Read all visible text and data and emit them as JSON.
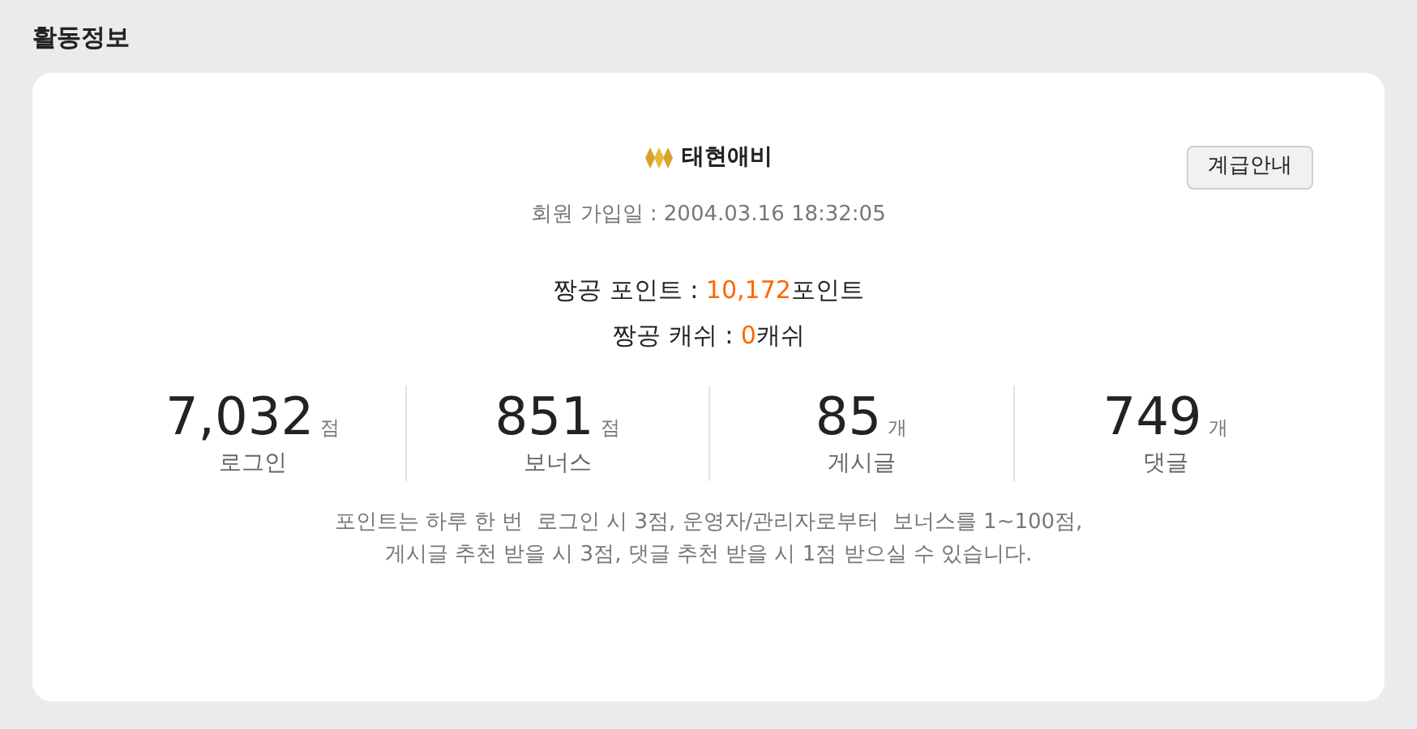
{
  "section_title": "활동정보",
  "member": {
    "name": "태현애비",
    "joined_label": "회원 가입일 : 2004.03.16 18:32:05",
    "grade_button": "계급안내"
  },
  "balances": [
    {
      "label": "짱공 포인트 : ",
      "value": "10,172",
      "unit": "포인트"
    },
    {
      "label": "짱공 캐쉬 : ",
      "value": "0",
      "unit": "캐쉬"
    }
  ],
  "stats": [
    {
      "value": "7,032",
      "unit": "점",
      "label": "로그인"
    },
    {
      "value": "851",
      "unit": "점",
      "label": "보너스"
    },
    {
      "value": "85",
      "unit": "개",
      "label": "게시글"
    },
    {
      "value": "749",
      "unit": "개",
      "label": "댓글"
    }
  ],
  "note": "포인트는 하루 한 번  로그인 시 3점, 운영자/관리자로부터  보너스를 1~100점,\n게시글 추천 받을 시 3점, 댓글 추천 받을 시 1점 받으실 수 있습니다."
}
